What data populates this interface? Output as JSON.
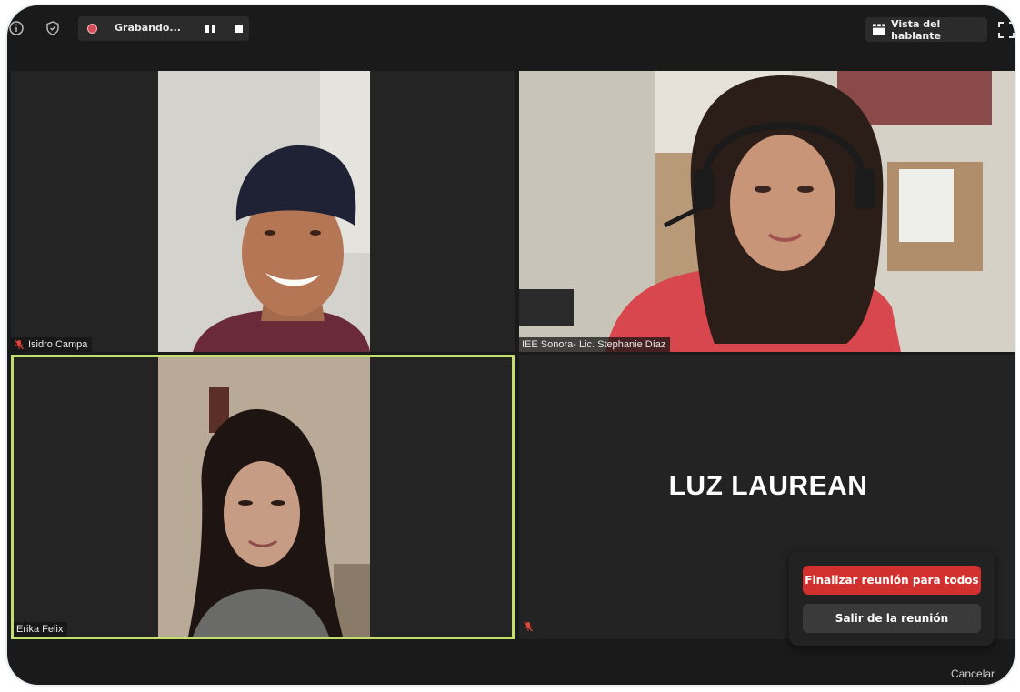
{
  "topbar": {
    "recording_label": "Grabando...",
    "speaker_view_label": "Vista del hablante"
  },
  "participants": [
    {
      "name": "Isidro Campa",
      "muted": true,
      "video": true
    },
    {
      "name": "IEE Sonora- Lic. Stephanie Díaz",
      "muted": false,
      "video": true
    },
    {
      "name": "Erika Felix",
      "muted": false,
      "video": true,
      "active_speaker": true
    },
    {
      "name": "LUZ LAUREAN",
      "muted": true,
      "video": false
    }
  ],
  "end_dialog": {
    "end_for_all_label": "Finalizar reunión para todos",
    "leave_label": "Salir de la reunión",
    "cancel_label": "Cancelar"
  },
  "colors": {
    "end_button": "#d22f2f",
    "active_border": "#c3de6a",
    "mute_icon": "#e0463c"
  }
}
